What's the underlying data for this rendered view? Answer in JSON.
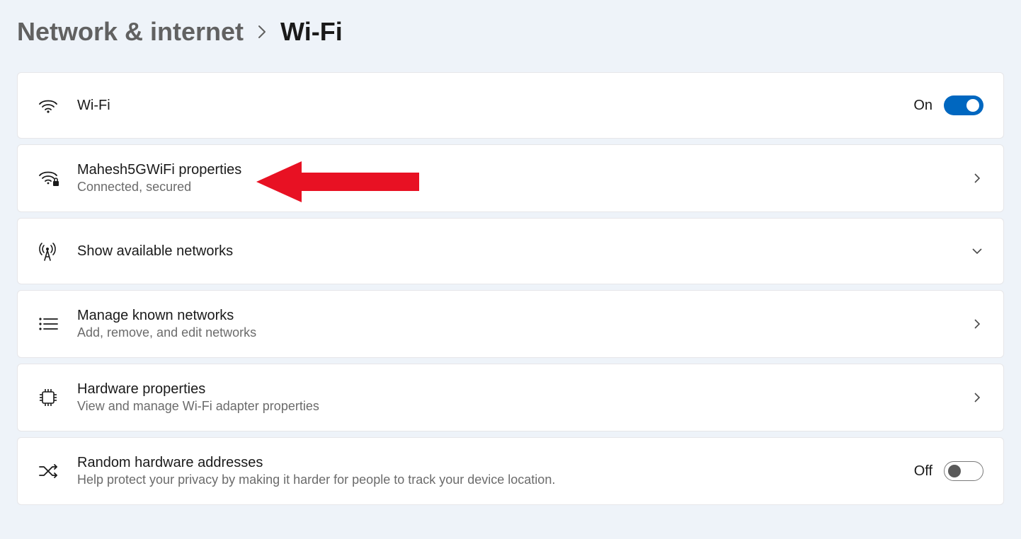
{
  "breadcrumb": {
    "parent": "Network & internet",
    "current": "Wi-Fi"
  },
  "items": {
    "wifi": {
      "title": "Wi-Fi",
      "state_label": "On",
      "toggle": true
    },
    "network_props": {
      "title": "Mahesh5GWiFi properties",
      "subtitle": "Connected, secured"
    },
    "show_networks": {
      "title": "Show available networks"
    },
    "manage_known": {
      "title": "Manage known networks",
      "subtitle": "Add, remove, and edit networks"
    },
    "hardware_props": {
      "title": "Hardware properties",
      "subtitle": "View and manage Wi-Fi adapter properties"
    },
    "random_hw": {
      "title": "Random hardware addresses",
      "subtitle": "Help protect your privacy by making it harder for people to track your device location.",
      "state_label": "Off",
      "toggle": false
    }
  }
}
